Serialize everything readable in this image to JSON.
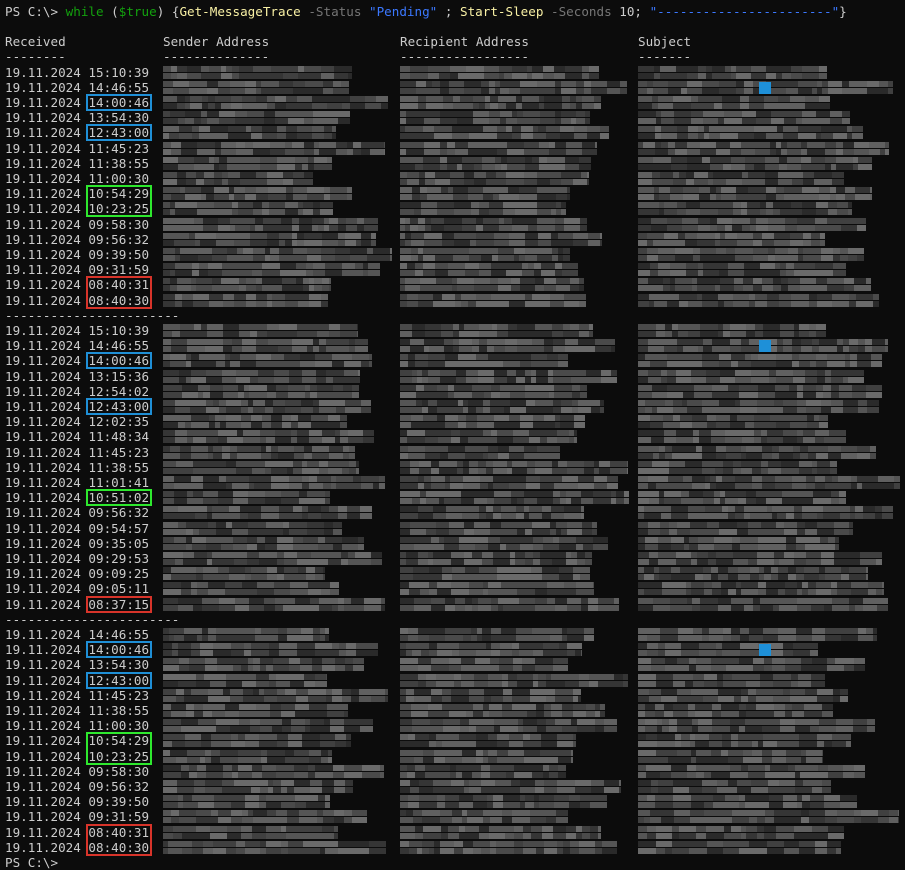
{
  "prompt": {
    "ps": "PS C:\\> ",
    "kw_while": "while",
    "paren_open": " (",
    "var_true": "$true",
    "paren_close": ") {",
    "cmd1": "Get-MessageTrace",
    "param_status": " -Status ",
    "str_pending": "\"Pending\"",
    "sep": " ; ",
    "cmd2": "Start-Sleep",
    "param_seconds": " -Seconds ",
    "num_10": "10",
    "semi": "; ",
    "str_dashes": "\"-----------------------\"",
    "brace_close": "}"
  },
  "headers": {
    "received": "Received",
    "sender": "Sender Address",
    "recipient": "Recipient Address",
    "subject": "Subject",
    "received_ul": "--------",
    "sender_ul": "--------------",
    "recipient_ul": "-----------------",
    "subject_ul": "-------"
  },
  "separator": "-----------------------",
  "final_prompt": "PS C:\\>",
  "date": "19.11.2024",
  "blocks": [
    {
      "times": [
        "15:10:39",
        "14:46:55",
        "14:00:46",
        "13:54:30",
        "12:43:00",
        "11:45:23",
        "11:38:55",
        "11:00:30",
        "10:54:29",
        "10:23:25",
        "09:58:30",
        "09:56:32",
        "09:39:50",
        "09:31:59",
        "08:40:31",
        "08:40:30"
      ],
      "highlights": {
        "blue": [
          2,
          4
        ],
        "green": [
          8,
          9
        ],
        "red": [
          14,
          15
        ]
      }
    },
    {
      "times": [
        "15:10:39",
        "14:46:55",
        "14:00:46",
        "13:15:36",
        "12:54:02",
        "12:43:00",
        "12:02:35",
        "11:48:34",
        "11:45:23",
        "11:38:55",
        "11:01:41",
        "10:51:02",
        "09:56:32",
        "09:54:57",
        "09:35:05",
        "09:29:53",
        "09:09:25",
        "09:05:11",
        "08:37:15"
      ],
      "highlights": {
        "blue": [
          2,
          5
        ],
        "green": [
          11
        ],
        "red": [
          18
        ]
      }
    },
    {
      "times": [
        "14:46:55",
        "14:00:46",
        "13:54:30",
        "12:43:00",
        "11:45:23",
        "11:38:55",
        "11:00:30",
        "10:54:29",
        "10:23:25",
        "09:58:30",
        "09:56:32",
        "09:39:50",
        "09:31:59",
        "08:40:31",
        "08:40:30"
      ],
      "highlights": {
        "blue": [
          1,
          3
        ],
        "green": [
          7,
          8
        ],
        "red": [
          13,
          14
        ]
      }
    }
  ],
  "colors": {
    "blue": "#1f8fd6",
    "green": "#2ee82e",
    "red": "#d8342a",
    "background": "#0c0c0c",
    "text": "#cccccc"
  }
}
